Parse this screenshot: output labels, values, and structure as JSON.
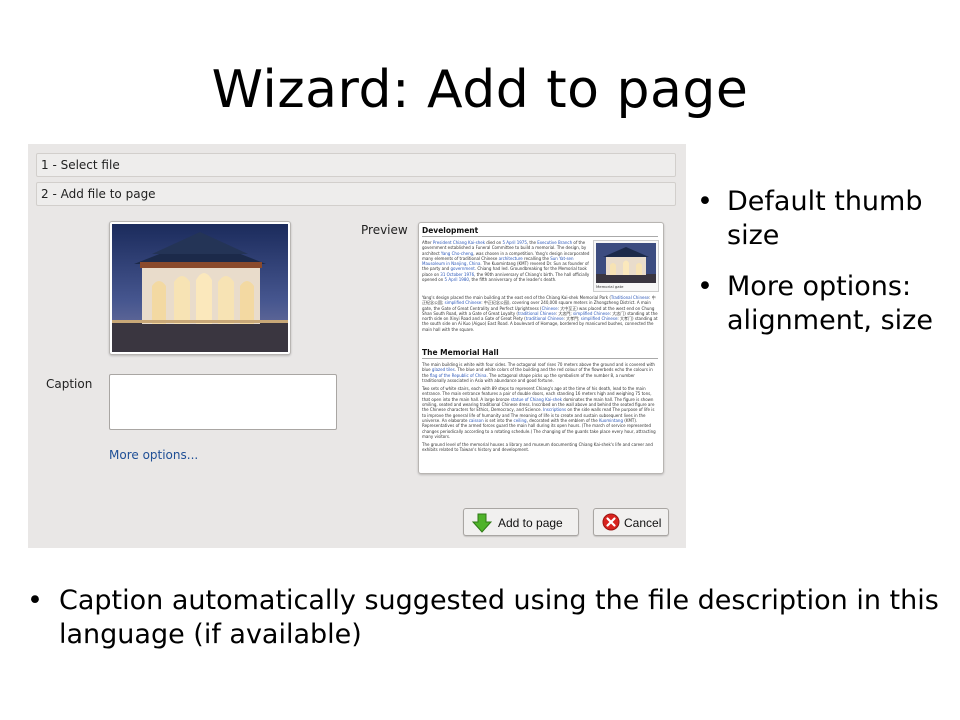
{
  "slide": {
    "title": "Wizard: Add to page",
    "right_bullets": [
      "Default thumb size",
      "More options: alignment, size"
    ],
    "bottom_bullet": "Caption automatically suggested using the file description in this language (if available)",
    "bullet_glyph": "•"
  },
  "wizard": {
    "steps": [
      "1 - Select file",
      "2 - Add file to page"
    ],
    "caption_label": "Caption",
    "caption_value": "",
    "more_options": "More options...",
    "preview_label": "Preview",
    "buttons": {
      "add": "Add to page",
      "cancel": "Cancel"
    },
    "icons": {
      "add": "green-down-arrow-icon",
      "cancel": "red-cancel-icon"
    }
  },
  "preview": {
    "heading1": "Development",
    "heading2": "The Memorial Hall",
    "figure_caption": "Memorial gate",
    "para1_runs": [
      {
        "t": "After "
      },
      {
        "t": "President Chiang Kai-shek",
        "link": true
      },
      {
        "t": " died on "
      },
      {
        "t": "5 April 1975",
        "link": true
      },
      {
        "t": ", the "
      },
      {
        "t": "Executive Branch",
        "link": true
      },
      {
        "t": " of the government established a Funeral Committee to build a memorial. The design, by architect "
      },
      {
        "t": "Yang Cho-cheng",
        "link": true
      },
      {
        "t": ", was chosen in a competition. Yang's design incorporated many elements of traditional Chinese "
      },
      {
        "t": "architecture",
        "link": true
      },
      {
        "t": " recalling the "
      },
      {
        "t": "Sun Yat-sen Mausoleum in Nanjing, China",
        "link": true
      },
      {
        "t": ". The Kuomintang (KMT) revered Dr. Sun as founder of the party and "
      },
      {
        "t": "government",
        "link": true
      },
      {
        "t": ". Chiang had led. Groundbreaking for the Memorial took place on "
      },
      {
        "t": "31 October 1976",
        "link": true
      },
      {
        "t": ", the 90th anniversary of Chiang's birth. The hall officially opened on "
      },
      {
        "t": "5 April 1980",
        "link": true
      },
      {
        "t": ", the fifth anniversary of the leader's death."
      }
    ],
    "para2_runs": [
      {
        "t": "Yang's design placed the main building at the east end of the Chiang Kai-shek Memorial Park ("
      },
      {
        "t": "Traditional Chinese",
        "link": true
      },
      {
        "t": ": 中正紀念公園; "
      },
      {
        "t": "simplified Chinese",
        "link": true
      },
      {
        "t": ": 中正纪念公园), covering over 240,000 square meters in Zhongzheng District. A main gate, the Gate of Great Centrality and Perfect Uprightness ("
      },
      {
        "t": "Chinese",
        "link": true
      },
      {
        "t": ": 大中至正) was placed at the west end on Chung Shan South Road, with a Gate of Great Loyalty ("
      },
      {
        "t": "traditional Chinese",
        "link": true
      },
      {
        "t": ": 大忠門; "
      },
      {
        "t": "simplified Chinese",
        "link": true
      },
      {
        "t": ": 大忠门) standing at the north side on Xinyi Road and a Gate of Great Piety ("
      },
      {
        "t": "traditional Chinese",
        "link": true
      },
      {
        "t": ": 大孝門; "
      },
      {
        "t": "simplified Chinese",
        "link": true
      },
      {
        "t": ": 大孝门) standing at the south side on Ai Kuo (Aiguo) East Road. A boulevard of Homage, bordered by manicured bushes, connected the main hall with the square."
      }
    ],
    "para3_runs": [
      {
        "t": "The main building is white with four sides. The octagonal roof rises 70 meters above the ground and is covered with blue "
      },
      {
        "t": "glazed tiles",
        "link": true
      },
      {
        "t": ". The blue and white colors of the building and the red colour of the flowerbeds echo the colours in the "
      },
      {
        "t": "flag of the Republic of China",
        "link": true
      },
      {
        "t": ". The octagonal shape picks up the symbolism of the number 8, a number traditionally associated in Asia with abundance and good fortune."
      }
    ],
    "para4_runs": [
      {
        "t": "Two sets of white stairs, each with 89 steps to represent Chiang's age at the time of his death, lead to the main entrance. The main entrance features a pair of double doors, each standing 16 meters high and weighing 75 tons, that open into the main hall. A large bronze "
      },
      {
        "t": "statue of Chiang Kai-shek",
        "link": true
      },
      {
        "t": " dominates the main hall. The figure is shown smiling, seated and wearing traditional Chinese dress. Inscribed on the wall above and behind the seated figure are the Chinese characters for Ethics, Democracy, and Science. "
      },
      {
        "t": "Inscriptions",
        "link": true
      },
      {
        "t": " on the side walls read The purpose of life is to improve the general life of humanity and The meaning of life is to create and sustain subsequent lives in the universe. An elaborate "
      },
      {
        "t": "caisson",
        "link": true
      },
      {
        "t": " is set into the "
      },
      {
        "t": "ceiling",
        "link": true
      },
      {
        "t": ", decorated with the emblem of the "
      },
      {
        "t": "Kuomintang",
        "link": true
      },
      {
        "t": " (KMT). Representatives of the armed forces guard the main hall during its open hours. (The march of service represented changes periodically according to a rotating schedule.) The changing of the guards take place every hour, attracting many visitors."
      }
    ],
    "para5_runs": [
      {
        "t": "The ground level of the memorial houses a library and museum documenting Chiang Kai-shek's life and career and exhibits related to Taiwan's history and development."
      }
    ]
  },
  "colors": {
    "link": "#1f4f96",
    "dialog_bg": "#e9e7e6",
    "add_icon": "#4fb32a",
    "cancel_icon": "#d8231f"
  }
}
